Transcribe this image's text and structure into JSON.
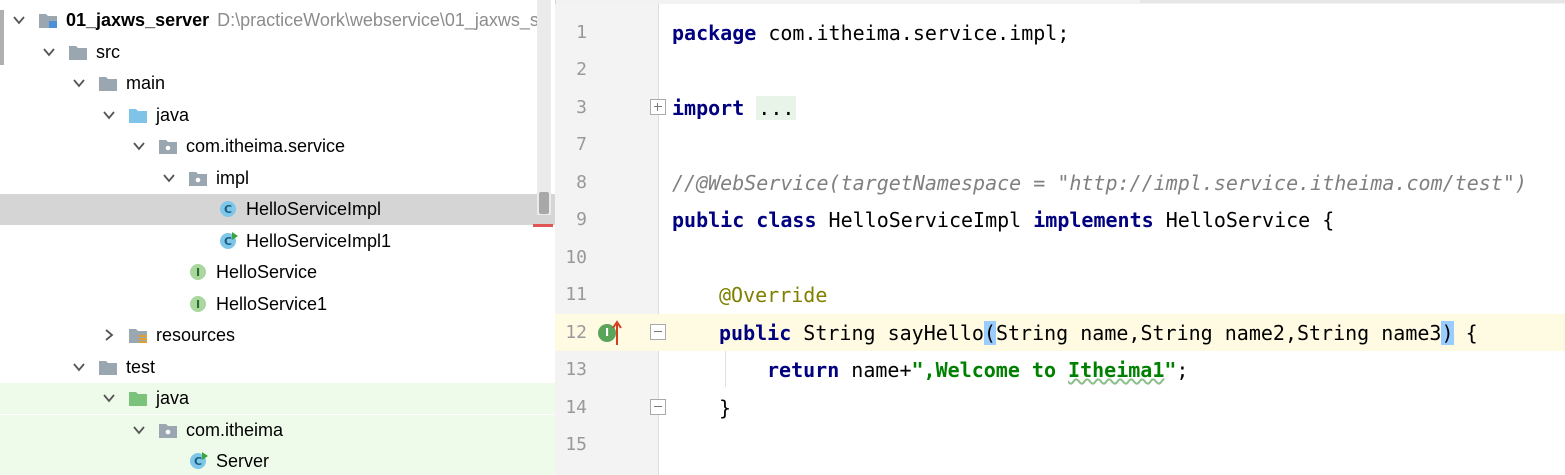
{
  "project_tree": {
    "items": [
      {
        "label": "01_jaxws_server",
        "path": "D:\\practiceWork\\webservice\\01_jaxws_s",
        "icon": "module-folder-icon",
        "expanded": true,
        "bold": true
      },
      {
        "label": "src",
        "icon": "folder-icon",
        "expanded": true
      },
      {
        "label": "main",
        "icon": "folder-icon",
        "expanded": true
      },
      {
        "label": "java",
        "icon": "source-root-folder-icon",
        "expanded": true
      },
      {
        "label": "com.itheima.service",
        "icon": "package-icon",
        "expanded": true
      },
      {
        "label": "impl",
        "icon": "package-icon",
        "expanded": true
      },
      {
        "label": "HelloServiceImpl",
        "icon": "class-icon",
        "selected": true
      },
      {
        "label": "HelloServiceImpl1",
        "icon": "runnable-class-icon"
      },
      {
        "label": "HelloService",
        "icon": "interface-icon"
      },
      {
        "label": "HelloService1",
        "icon": "interface-icon"
      },
      {
        "label": "resources",
        "icon": "resources-folder-icon",
        "expanded": false
      },
      {
        "label": "test",
        "icon": "folder-icon",
        "expanded": true
      },
      {
        "label": "java",
        "icon": "test-root-folder-icon",
        "expanded": true
      },
      {
        "label": "com.itheima",
        "icon": "package-icon",
        "expanded": true
      },
      {
        "label": "Server",
        "icon": "runnable-class-icon"
      }
    ]
  },
  "editor": {
    "line_numbers": [
      "1",
      "2",
      "3",
      "7",
      "8",
      "9",
      "10",
      "11",
      "12",
      "13",
      "14",
      "15"
    ],
    "lines": {
      "l1_kw": "package",
      "l1_rest": " com.itheima.service.impl;",
      "l3_kw": "import",
      "l3_fold": "...",
      "l8_comment": "//@WebService(targetNamespace = \"http://impl.service.itheima.com/test\")",
      "l9_kw1": "public",
      "l9_kw2": "class",
      "l9_name": " HelloServiceImpl ",
      "l9_kw3": "implements",
      "l9_rest": " HelloService {",
      "l11_ann": "@Override",
      "l12_kw": "public",
      "l12_mid": " String sayHello",
      "l12_paren_open": "(",
      "l12_params": "String name,String name2,String name3",
      "l12_paren_close": ")",
      "l12_end": " {",
      "l13_kw": "return",
      "l13_mid": " name+",
      "l13_str_q1": "\"",
      "l13_str": ",Welcome to ",
      "l13_str_word": "Itheima1",
      "l13_str_q2": "\"",
      "l13_end": ";",
      "l14_brace": "}"
    },
    "gutter_badge": "I"
  }
}
